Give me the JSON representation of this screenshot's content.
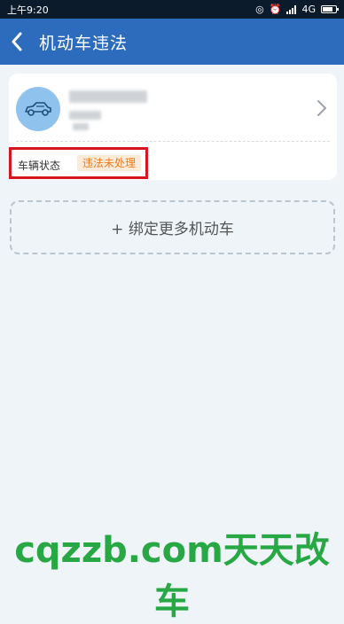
{
  "statusbar": {
    "time": "上午9:20",
    "network": "4G"
  },
  "header": {
    "title": "机动车违法"
  },
  "vehicle_card": {
    "status_label": "车辆状态",
    "status_value": "违法未处理"
  },
  "add_button": {
    "label": "+ 绑定更多机动车"
  },
  "watermark": {
    "text": "cqzzb.com天天改车"
  },
  "colors": {
    "header": "#2d6cbd",
    "badge_text": "#f07a1e",
    "badge_bg": "#fdebd8",
    "highlight": "#d6161c",
    "watermark": "#28a745"
  }
}
